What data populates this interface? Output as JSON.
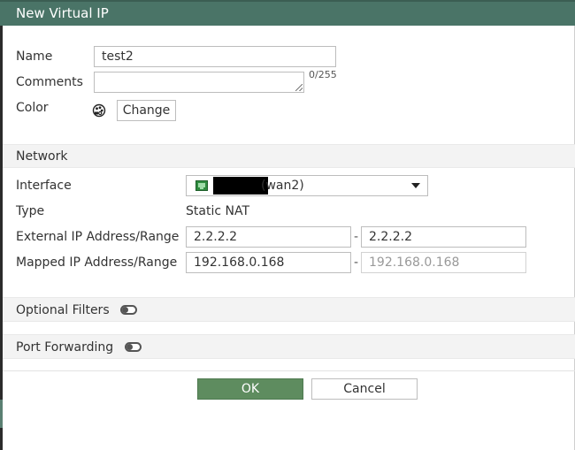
{
  "dialog": {
    "title": "New Virtual IP"
  },
  "form": {
    "name_label": "Name",
    "name_value": "test2",
    "comments_label": "Comments",
    "comments_value": "",
    "comments_counter": "0/255",
    "color_label": "Color",
    "color_icon": "palette-icon",
    "change_label": "Change"
  },
  "network": {
    "section_label": "Network",
    "interface_label": "Interface",
    "interface_icon": "network-port-icon",
    "interface_value": "(wan2)",
    "type_label": "Type",
    "type_value": "Static NAT",
    "external_label": "External IP Address/Range",
    "external_start": "2.2.2.2",
    "external_end": "2.2.2.2",
    "mapped_label": "Mapped IP Address/Range",
    "mapped_start": "192.168.0.168",
    "mapped_end": "192.168.0.168",
    "range_separator": "-"
  },
  "optional_filters": {
    "label": "Optional Filters",
    "enabled": false
  },
  "port_forwarding": {
    "label": "Port Forwarding",
    "enabled": false
  },
  "actions": {
    "ok_label": "OK",
    "cancel_label": "Cancel"
  },
  "colors": {
    "title_bar": "#4a7467",
    "ok_button": "#5e8c5f",
    "section_bg": "#f3f3f3"
  }
}
